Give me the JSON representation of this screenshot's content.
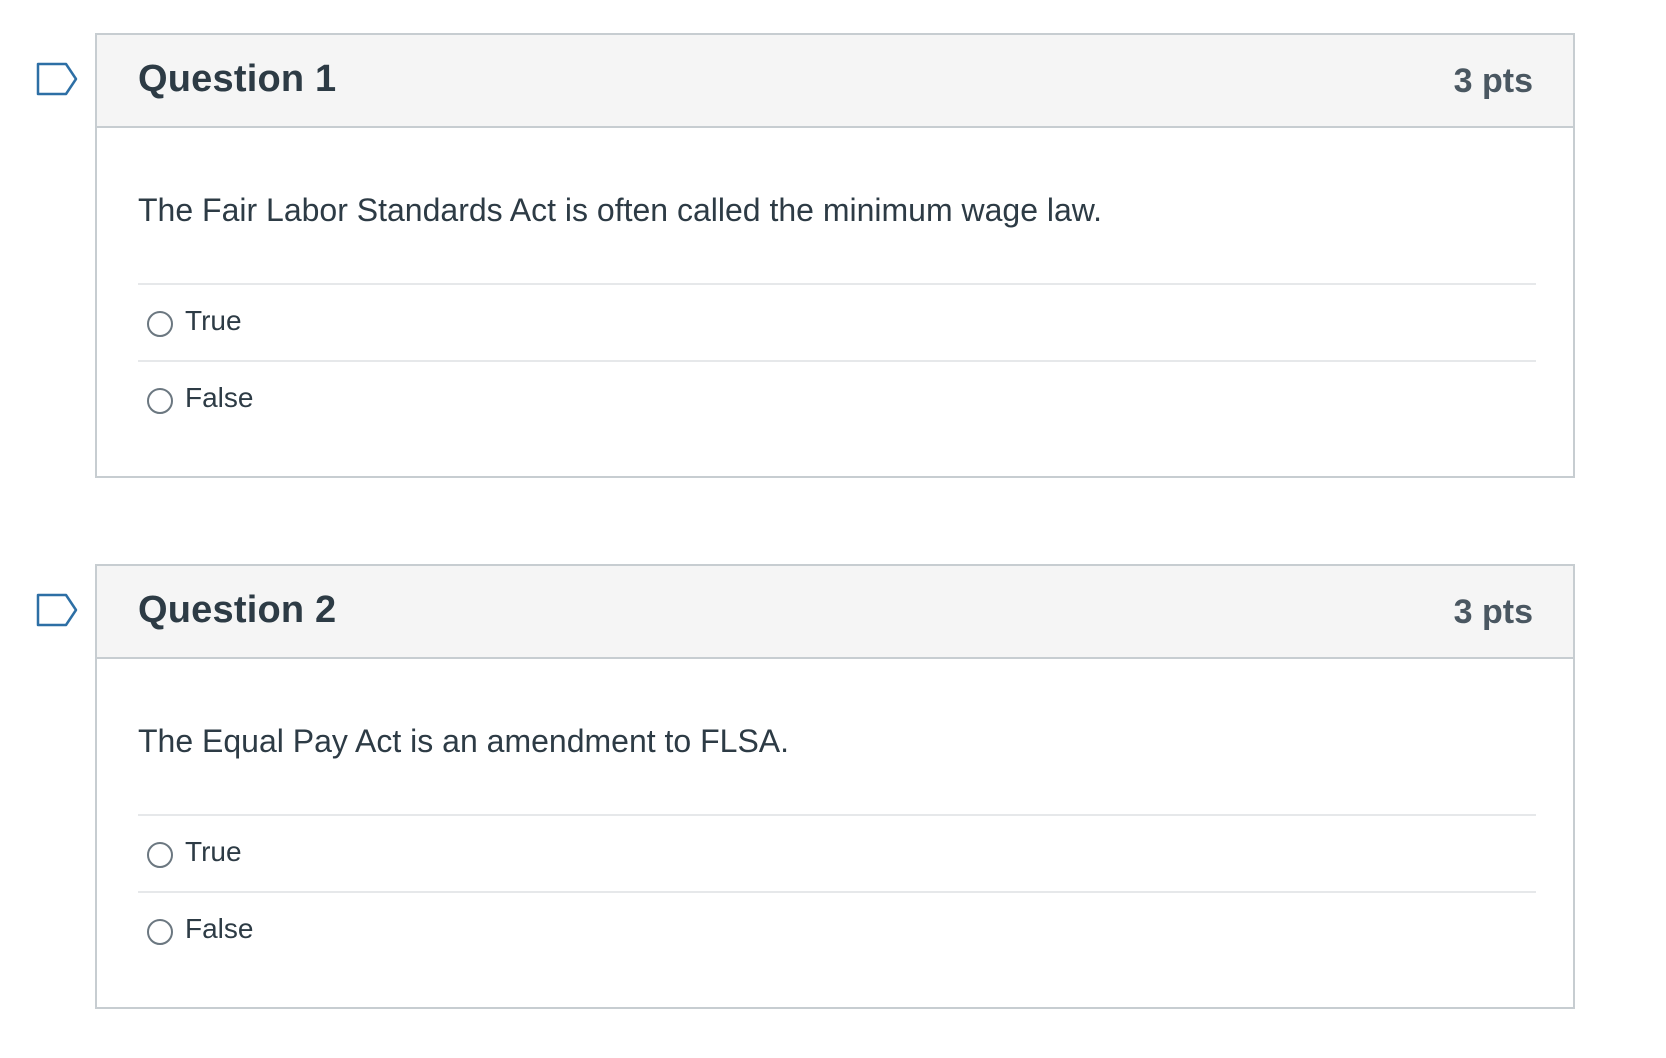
{
  "questions": [
    {
      "title": "Question 1",
      "points": "3 pts",
      "text": "The Fair Labor Standards Act is often called the minimum wage law.",
      "answers": [
        "True",
        "False"
      ],
      "selected": null
    },
    {
      "title": "Question 2",
      "points": "3 pts",
      "text": "The Equal Pay Act is an amendment to FLSA.",
      "answers": [
        "True",
        "False"
      ],
      "selected": null
    }
  ],
  "colors": {
    "header_bg": "#f5f5f5",
    "border": "#c7cdd1",
    "text": "#2d3b45",
    "flag_outline": "#2d6fa5"
  },
  "icons": {
    "flag": "bookmark-flag-icon",
    "radio": "radio-unchecked-icon"
  }
}
